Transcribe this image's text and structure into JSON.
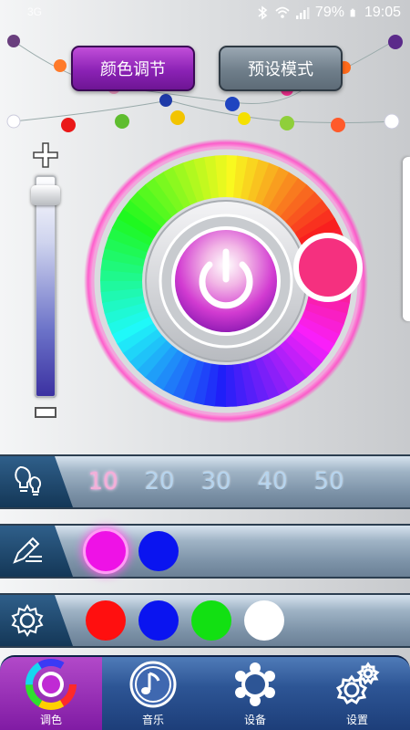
{
  "status_bar": {
    "sim": "3G",
    "battery": "79%",
    "time": "19:05",
    "icons": [
      "bluetooth-icon",
      "wifi-icon",
      "signal-icon",
      "battery-icon"
    ]
  },
  "mode_tabs": [
    {
      "label": "颜色调节",
      "active": true
    },
    {
      "label": "预设模式",
      "active": false
    }
  ],
  "brightness": {
    "plus_icon": "plus-icon",
    "minus_icon": "minus-icon",
    "level": 0.95
  },
  "color_wheel": {
    "selected_color": "#f5307f",
    "power_icon": "power-icon",
    "ring_glow": "#ff66cc"
  },
  "timer_row": {
    "icon": "lightbulbs-icon",
    "options": [
      "10",
      "20",
      "30",
      "40",
      "50"
    ],
    "active_index": 0
  },
  "custom_row": {
    "icon": "edit-icon",
    "swatches": [
      {
        "color": "#ee12e6",
        "selected": true
      },
      {
        "color": "#0a14f0",
        "selected": false
      }
    ]
  },
  "preset_row": {
    "icon": "gear-icon",
    "swatches": [
      {
        "color": "#ff0f0f"
      },
      {
        "color": "#0a14f0"
      },
      {
        "color": "#12e012"
      },
      {
        "color": "#ffffff"
      }
    ]
  },
  "bottom_nav": [
    {
      "label": "调色",
      "icon": "color-wheel-icon",
      "active": true
    },
    {
      "label": "音乐",
      "icon": "music-icon",
      "active": false
    },
    {
      "label": "设备",
      "icon": "device-icon",
      "active": false
    },
    {
      "label": "设置",
      "icon": "settings-icon",
      "active": false
    }
  ]
}
